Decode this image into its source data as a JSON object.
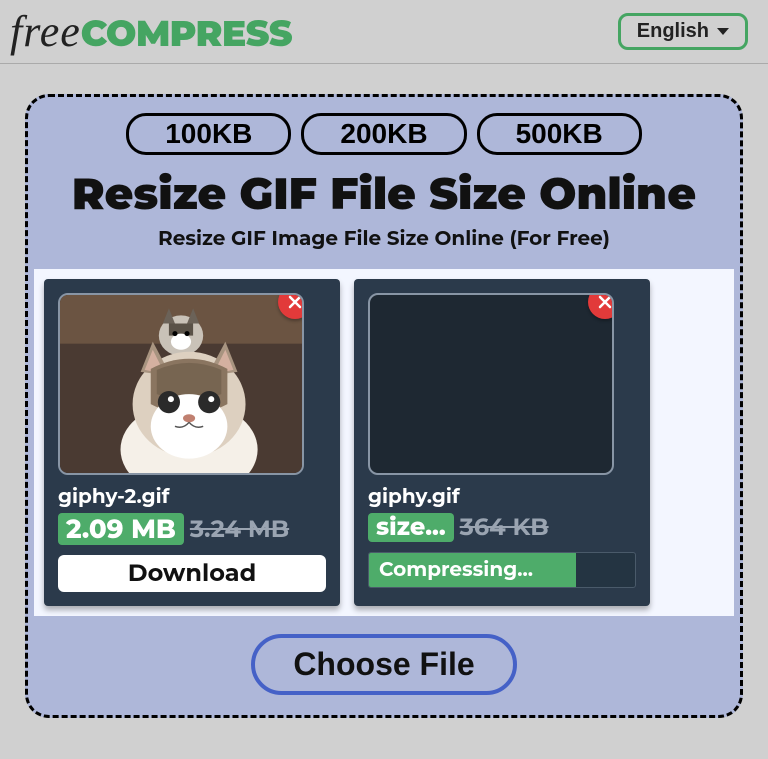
{
  "header": {
    "logo_free": "free",
    "logo_compress": "COMPRESS",
    "language": "English"
  },
  "size_tabs": [
    "100KB",
    "200KB",
    "500KB"
  ],
  "title": "Resize GIF File Size Online",
  "subtitle": "Resize GIF Image File Size Online (For Free)",
  "cards": [
    {
      "filename": "giphy-2.gif",
      "new_size": "2.09 MB",
      "old_size": "3.24 MB",
      "action_label": "Download",
      "status": "done"
    },
    {
      "filename": "giphy.gif",
      "new_size": "size...",
      "old_size": "364 KB",
      "action_label": "Compressing...",
      "status": "compressing"
    }
  ],
  "choose_file": "Choose File"
}
